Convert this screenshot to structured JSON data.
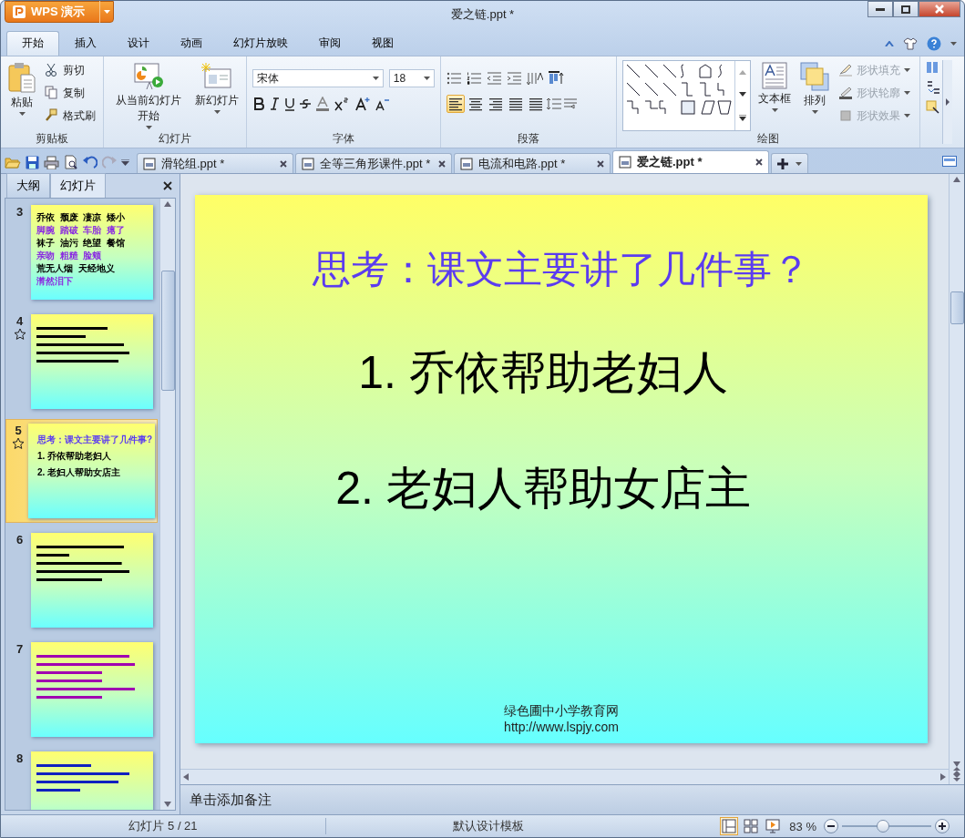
{
  "app_menu": {
    "label": "WPS 演示"
  },
  "window": {
    "title": "爱之链.ppt *"
  },
  "ribbon_tabs": [
    {
      "label": "开始",
      "selected": true
    },
    {
      "label": "插入",
      "selected": false
    },
    {
      "label": "设计",
      "selected": false
    },
    {
      "label": "动画",
      "selected": false
    },
    {
      "label": "幻灯片放映",
      "selected": false
    },
    {
      "label": "审阅",
      "selected": false
    },
    {
      "label": "视图",
      "selected": false
    }
  ],
  "clipboard": {
    "title": "剪贴板",
    "paste": "粘贴",
    "commands": [
      "剪切",
      "复制",
      "格式刷"
    ]
  },
  "slides_group": {
    "title": "幻灯片",
    "from_current": "从当前幻灯片开始",
    "new_slide": "新幻灯片"
  },
  "font_group": {
    "title": "字体",
    "font_name": "宋体",
    "font_size": "18"
  },
  "paragraph_group": {
    "title": "段落",
    "align_buttons": [
      {
        "selected": true
      },
      {
        "selected": false
      },
      {
        "selected": false
      },
      {
        "selected": false
      },
      {
        "selected": false
      }
    ]
  },
  "drawing_group": {
    "title": "绘图",
    "textbox": "文本框",
    "arrange": "排列",
    "shape_commands": [
      {
        "label": "形状填充",
        "disabled": true
      },
      {
        "label": "形状轮廓",
        "disabled": true
      },
      {
        "label": "形状效果",
        "disabled": true
      }
    ]
  },
  "doc_tabs": [
    {
      "label": "滑轮组.ppt *",
      "selected": false
    },
    {
      "label": "全等三角形课件.ppt *",
      "selected": false
    },
    {
      "label": "电流和电路.ppt *",
      "selected": false
    },
    {
      "label": "爱之链.ppt *",
      "selected": true
    }
  ],
  "side_panel": {
    "tabs": [
      {
        "label": "大纲",
        "selected": false
      },
      {
        "label": "幻灯片",
        "selected": true
      }
    ],
    "thumbnails": [
      {
        "number": "3",
        "selected": false,
        "starred": false,
        "kind": "text",
        "lines": [
          {
            "text": "乔依  颓废  凄凉  矮小",
            "color": "#000000"
          },
          {
            "text": "脚腕  踏破  车胎  瘪了",
            "color": "#8a2be2"
          },
          {
            "text": "袜子  油污  绝望  餐馆",
            "color": "#000000"
          },
          {
            "text": "亲吻  粗糙  脸颊",
            "color": "#8a2be2"
          },
          {
            "text": "荒无人烟  天经地义",
            "color": "#000000"
          },
          {
            "text": "潸然泪下",
            "color": "#8a2be2"
          }
        ]
      },
      {
        "number": "4",
        "selected": false,
        "starred": true,
        "kind": "illegible",
        "color": "#000000"
      },
      {
        "number": "5",
        "selected": true,
        "starred": true,
        "kind": "text",
        "lines": [
          {
            "text": "思考：课文主要讲了几件事?",
            "color": "#5b3cf0"
          },
          {
            "text": "1. 乔依帮助老妇人",
            "color": "#000000"
          },
          {
            "text": "2. 老妇人帮助女店主",
            "color": "#000000"
          }
        ]
      },
      {
        "number": "6",
        "selected": false,
        "starred": false,
        "kind": "illegible",
        "color": "#000000"
      },
      {
        "number": "7",
        "selected": false,
        "starred": false,
        "kind": "illegible",
        "color": "#a000b0"
      },
      {
        "number": "8",
        "selected": false,
        "starred": false,
        "kind": "illegible",
        "color": "#1020c0"
      }
    ]
  },
  "slide": {
    "title": "思考：课文主要讲了几件事？",
    "points": [
      "1. 乔依帮助老妇人",
      "2. 老妇人帮助女店主"
    ],
    "footer": [
      "绿色圃中小学教育网",
      "http://www.lspjy.com"
    ]
  },
  "notes": {
    "prompt": "单击添加备注"
  },
  "status_bar": {
    "slide_counter": "幻灯片 5 / 21",
    "template": "默认设计模板",
    "views": [
      {
        "kind": "normal",
        "selected": true
      },
      {
        "kind": "sorter",
        "selected": false
      },
      {
        "kind": "show",
        "selected": false
      }
    ],
    "zoom": "83 %",
    "zoom_slider": {
      "level": 0.45
    }
  }
}
